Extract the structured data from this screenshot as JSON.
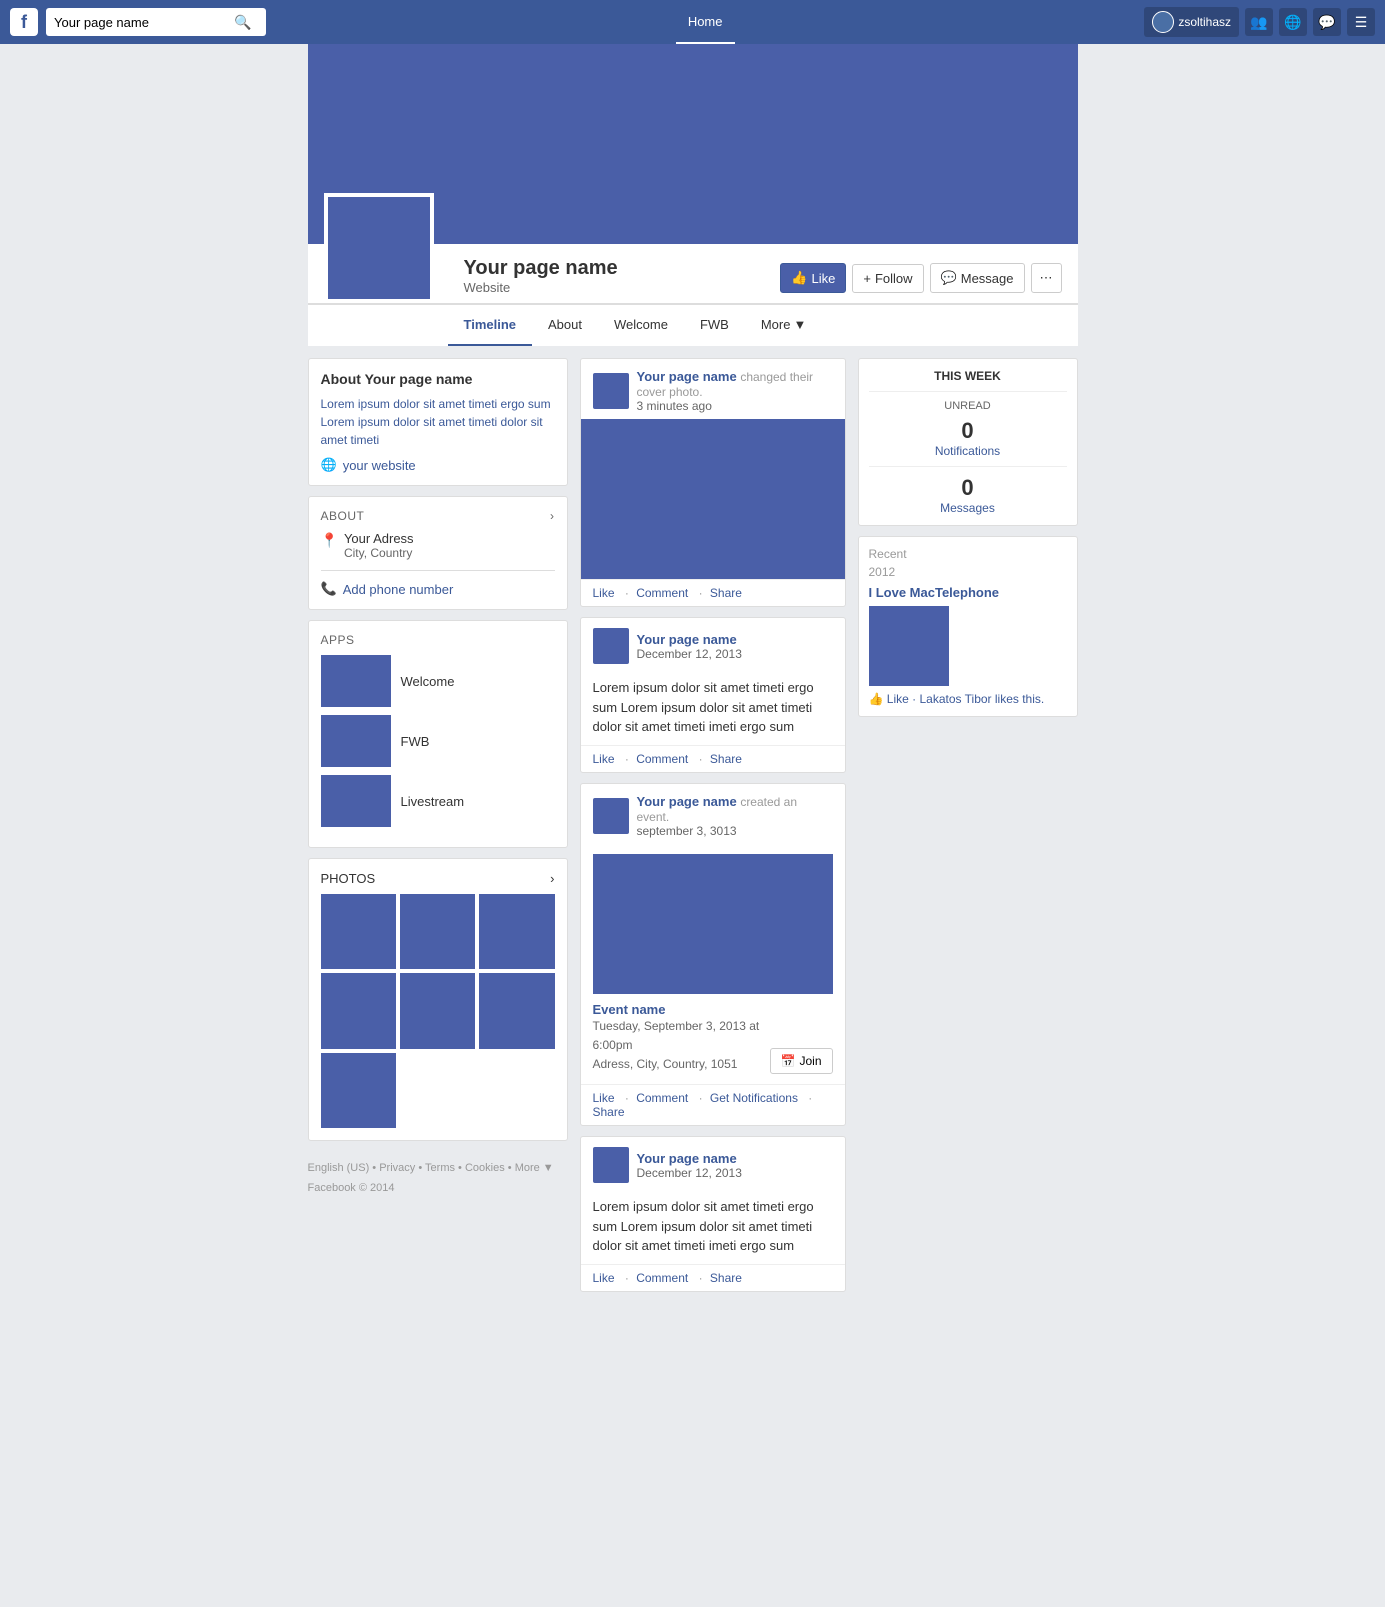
{
  "topnav": {
    "logo": "f",
    "search_placeholder": "Your page name",
    "search_value": "Your page name",
    "home_label": "Home",
    "user_name": "zsoltihasz",
    "icons": [
      "people-icon",
      "globe-icon",
      "chat-icon",
      "menu-icon"
    ]
  },
  "cover": {
    "page_name": "Your page name",
    "website_label": "Website"
  },
  "tabs": [
    {
      "label": "Timeline",
      "active": true
    },
    {
      "label": "About"
    },
    {
      "label": "Welcome"
    },
    {
      "label": "FWB"
    },
    {
      "label": "More",
      "has_dropdown": true
    }
  ],
  "actions": {
    "like": "Like",
    "follow": "Follow",
    "message": "Message"
  },
  "sidebar": {
    "about_title": "About Your page name",
    "about_text": "Lorem ipsum dolor sit amet timeti ergo sum Lorem ipsum dolor sit amet timeti dolor sit amet timeti",
    "website": "your website",
    "section_about": "ABOUT",
    "address_name": "Your Adress",
    "address_sub": "City, Country",
    "phone_label": "Add phone number",
    "apps_section": "APPS",
    "apps": [
      {
        "name": "Welcome"
      },
      {
        "name": "FWB"
      },
      {
        "name": "Livestream"
      }
    ],
    "photos_section": "PHOTOS",
    "photos_count": 7
  },
  "feed": {
    "posts": [
      {
        "id": 1,
        "author": "Your page name",
        "action": "changed their cover photo.",
        "time": "3 minutes ago",
        "has_image": true,
        "actions": [
          "Like",
          "Comment",
          "Share"
        ]
      },
      {
        "id": 2,
        "author": "Your page name",
        "time": "December 12, 2013",
        "body": "Lorem ipsum dolor sit amet timeti ergo sum Lorem ipsum dolor sit amet timeti dolor sit amet timeti imeti ergo sum",
        "actions": [
          "Like",
          "Comment",
          "Share"
        ]
      },
      {
        "id": 3,
        "author": "Your page name",
        "action": "created an event.",
        "time": "september 3, 3013",
        "is_event": true,
        "event_name": "Event name",
        "event_date": "Tuesday, September 3, 2013 at 6:00pm",
        "event_address": "Adress, City, Country, 1051",
        "event_join_label": "Join",
        "actions": [
          "Like",
          "Comment",
          "Get Notifications",
          "Share"
        ]
      },
      {
        "id": 4,
        "author": "Your page name",
        "time": "December 12, 2013",
        "body": "Lorem ipsum dolor sit amet timeti ergo sum Lorem ipsum dolor sit amet timeti dolor sit amet timeti imeti ergo sum",
        "actions": [
          "Like",
          "Comment",
          "Share"
        ]
      }
    ]
  },
  "right_sidebar": {
    "this_week_label": "THIS WEEK",
    "unread_label": "UNREAD",
    "notifications_count": "0",
    "notifications_label": "Notifications",
    "messages_count": "0",
    "messages_label": "Messages",
    "recent_label": "Recent",
    "recent_year": "2012",
    "recent_page_name": "I Love MacTelephone",
    "like_label": "Like",
    "dot": "·",
    "likes_text": "Lakatos Tibor likes this."
  },
  "footer": {
    "links": [
      "English (US)",
      "Privacy",
      "Terms",
      "Cookies",
      "More"
    ],
    "copyright": "Facebook © 2014"
  }
}
